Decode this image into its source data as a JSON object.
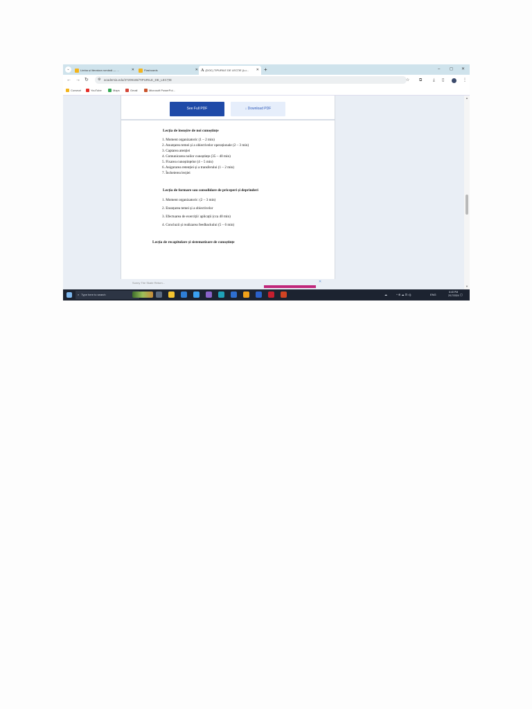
{
  "browser": {
    "tabs": [
      {
        "label": "Limba și literatura română — ...",
        "active": false
      },
      {
        "label": "Flashcards",
        "active": false
      },
      {
        "label": "(DOC) TIPURILE DE LECȚIE (Lu...",
        "active": true
      }
    ],
    "new_tab": "+",
    "window_controls": {
      "minimize": "–",
      "maximize": "◻",
      "close": "✕"
    },
    "url": "academia.edu/37209165/TIPURILE_DE_LECȚIE",
    "bookmarks": [
      "Curseuri",
      "YouTube",
      "Maps",
      "Gmail",
      "Microsoft PowerPoi..."
    ]
  },
  "document": {
    "see_full_pdf": "See Full PDF",
    "download_pdf": "Download PDF",
    "section1": {
      "title": "Lecția de însușire de noi cunoștințe",
      "items": [
        "1. Moment organizatoric (1 – 2 min)",
        "2. Anunțarea temei și a obiectivelor operaționale (2 – 3 min)",
        "3. Captarea atenției",
        "4. Comunicarea noilor cunoștințe (35 – 40 min)",
        "5. Fixarea cunoștințelor (4 – 5 min)",
        "6. Asigurarea retenției și a transferului (1 – 2 min)",
        "7. Încheierea lecției"
      ]
    },
    "section2": {
      "title": "Lecția de formare sau consolidare de priceperi și deprinderi",
      "items": [
        "1. Moment organizatoric: (2 – 3 min)",
        "2. Enunțarea temei și a obiectivelor",
        "3. Efectuarea de exerciții/ aplicații (cca 40 min)",
        "4. Concluzii și realizarea feedbackului (5 – 6 min)"
      ]
    },
    "section3": {
      "title": "Lecția de recapitulare și sistematizare de cunoștințe"
    },
    "ad_text": "Sunny The Skate Return..."
  },
  "taskbar": {
    "search_placeholder": "Type here to search",
    "lang": "ENG",
    "time": "6:40 PM",
    "date": "2/17/2024"
  }
}
